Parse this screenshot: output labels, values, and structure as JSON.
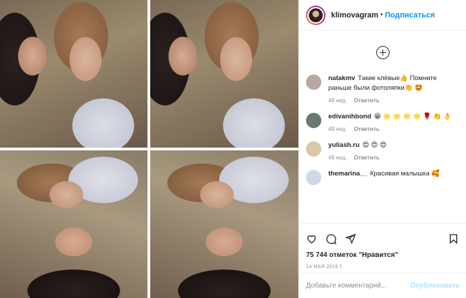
{
  "post": {
    "image_alt": ""
  },
  "header": {
    "username": "klimovagram",
    "separator": "•",
    "follow_label": "Подписаться"
  },
  "comments": [
    {
      "username": "natakmv",
      "text": "Такие клёвые👍 Помните раньше были фотоляпки👏 🤩",
      "age": "49 нед.",
      "reply_label": "Ответить",
      "avatar_color": "#b8a8a0"
    },
    {
      "username": "edivanihbond",
      "text": "😁 🌟 🌟 🌟 🌟 🌹 👏 👌",
      "age": "49 нед.",
      "reply_label": "Ответить",
      "avatar_color": "#6a7a6a"
    },
    {
      "username": "yuliash.ru",
      "text": "😍 😍 😍",
      "age": "49 нед.",
      "reply_label": "Ответить",
      "avatar_color": "#d8c8a8"
    },
    {
      "username": "themarina__",
      "text": "Красивая малышка 🥰",
      "age": "",
      "reply_label": "",
      "avatar_color": "#d0d8e8"
    }
  ],
  "actions": {
    "icons": [
      "heart-icon",
      "comment-icon",
      "share-icon",
      "bookmark-icon"
    ],
    "likes": "75 744 отметок \"Нравится\"",
    "date": "14 МАЯ 2019 Г."
  },
  "add_comment": {
    "placeholder": "Добавьте комментарий...",
    "publish_label": "Опубликовать"
  },
  "colors": {
    "accent": "#0095f6",
    "publish_disabled": "#b2dffc",
    "muted": "#8e8e8e"
  }
}
